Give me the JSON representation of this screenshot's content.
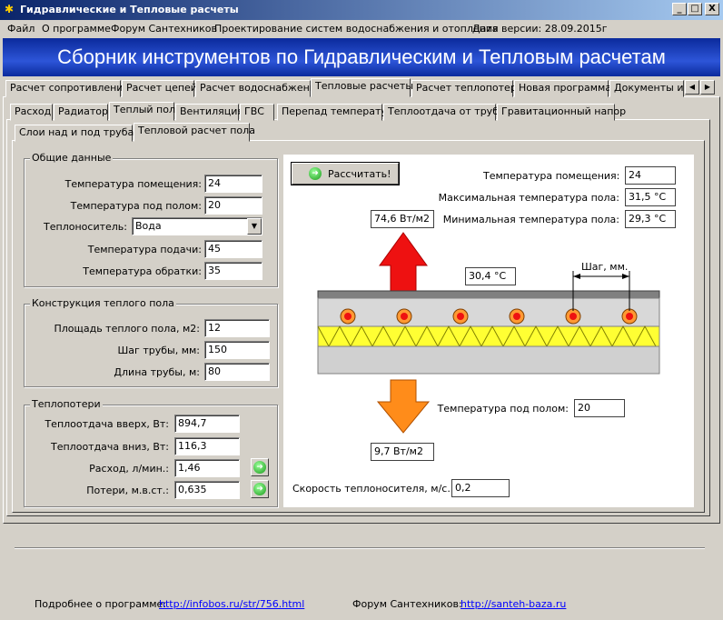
{
  "window": {
    "title": "Гидравлические и Тепловые расчеты",
    "minimize": "_",
    "maximize": "□",
    "close": "X"
  },
  "menu": [
    "Файл",
    "О программе",
    "Форум Сантехников",
    "Проектирование систем водоснабжения и отопления",
    "Дата версии: 28.09.2015г"
  ],
  "banner": "Сборник инструментов по Гидравлическим и Тепловым расчетам",
  "main_tabs": [
    "Расчет сопротивлений",
    "Расчет цепей",
    "Расчет водоснабжения",
    "Тепловые расчеты",
    "Расчет теплопотерь",
    "Новая программа",
    "Документы и л"
  ],
  "main_tabs_active": "Тепловые расчеты",
  "sub_tabs": [
    "Расход",
    "Радиатор",
    "Теплый пол",
    "Вентиляция",
    "ГВС",
    "Перепад температур",
    "Теплоотдача от трубы",
    "Гравитационный напор"
  ],
  "sub_tabs_active": "Теплый пол",
  "inner_tabs": [
    "Слои над и под трубами",
    "Тепловой расчет пола"
  ],
  "inner_tabs_active": "Тепловой расчет пола",
  "general": {
    "title": "Общие данные",
    "room_temp_label": "Температура помещения:",
    "room_temp": "24",
    "under_temp_label": "Температура под полом:",
    "under_temp": "20",
    "coolant_label": "Теплоноситель:",
    "coolant": "Вода",
    "supply_temp_label": "Температура подачи:",
    "supply_temp": "45",
    "return_temp_label": "Температура обратки:",
    "return_temp": "35"
  },
  "construction": {
    "title": "Конструкция теплого пола",
    "area_label": "Площадь теплого пола, м2:",
    "area": "12",
    "pitch_label": "Шаг трубы, мм:",
    "pitch": "150",
    "length_label": "Длина трубы, м:",
    "length": "80"
  },
  "losses": {
    "title": "Теплопотери",
    "up_label": "Теплоотдача вверх, Вт:",
    "up": "894,7",
    "down_label": "Теплоотдача вниз, Вт:",
    "down": "116,3",
    "flow_label": "Расход, л/мин.:",
    "flow": "1,46",
    "head_label": "Потери, м.в.ст.:",
    "head": "0,635"
  },
  "diagram": {
    "calc_button": "Рассчитать!",
    "room_temp_label": "Температура помещения:",
    "room_temp": "24",
    "max_floor_label": "Максимальная температура пола:",
    "max_floor": "31,5 °C",
    "min_floor_label": "Минимальная температура пола:",
    "min_floor": "29,3 °C",
    "up_flux": "74,6 Вт/м2",
    "surface_temp": "30,4 °C",
    "pitch_label": "Шаг, мм.",
    "under_temp_label": "Температура под полом:",
    "under_temp": "20",
    "down_flux": "9,7 Вт/м2",
    "velocity_label": "Скорость теплоносителя, м/с.:",
    "velocity": "0,2",
    "colors": {
      "up_arrow": "#ee1111",
      "down_arrow": "#ff8c1a",
      "insulation": "#ffff33",
      "pipe": "#ee1111",
      "pipe_ring": "#ff9933",
      "slab": "#d0d0d0"
    }
  },
  "footer": {
    "about_label": "Подробнее о программе:",
    "about_link": "http://infobos.ru/str/756.html",
    "forum_label": "Форум Сантехников:",
    "forum_link": "http://santeh-baza.ru"
  }
}
